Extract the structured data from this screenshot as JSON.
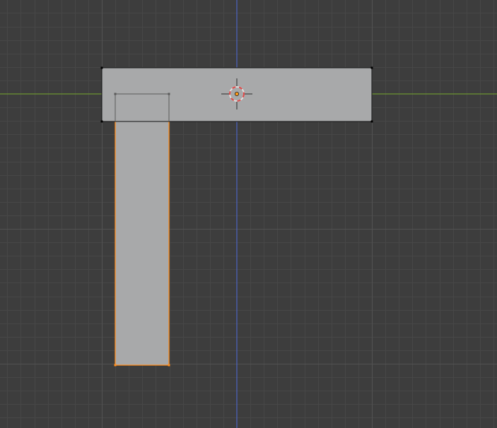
{
  "viewport": {
    "view": "top-orthographic",
    "background_color": "#3d3d3d",
    "grid_minor_color": "#474747",
    "grid_major_color": "#525252",
    "axis_x_color": "#6b9431",
    "axis_y_color": "#4d63c2"
  },
  "objects": [
    {
      "name": "horizontal-bar",
      "selected": false,
      "fill_color": "#a8a9aa",
      "edge_color": "#000000"
    },
    {
      "name": "vertical-bar",
      "selected": true,
      "fill_color": "#a8a9aa",
      "edge_color": "#ff8d1c"
    }
  ],
  "cursor": {
    "name": "3d-cursor",
    "ring_color_a": "#e0e0e0",
    "ring_color_b": "#e04848"
  },
  "origin": {
    "color": "#ff9c1a"
  }
}
